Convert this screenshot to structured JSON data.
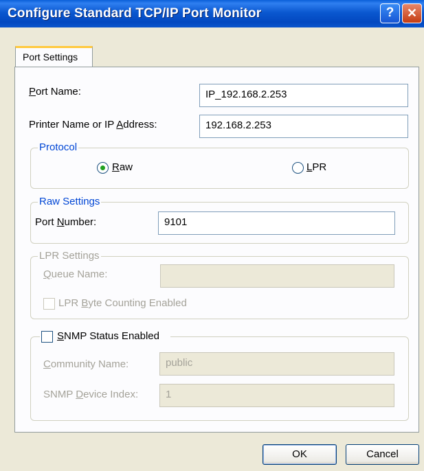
{
  "window": {
    "title": "Configure Standard TCP/IP Port Monitor",
    "help_glyph": "?",
    "close_glyph": "✕"
  },
  "tab": {
    "label": "Port Settings"
  },
  "port_name": {
    "label_pre": "",
    "label_key": "P",
    "label_post": "ort Name:",
    "value": "IP_192.168.2.253"
  },
  "printer_address": {
    "label_pre": "Printer Name or IP ",
    "label_key": "A",
    "label_post": "ddress:",
    "value": "192.168.2.253"
  },
  "protocol": {
    "legend": "Protocol",
    "raw": {
      "key": "R",
      "rest": "aw",
      "selected": true
    },
    "lpr": {
      "key": "L",
      "rest": "PR",
      "selected": false
    }
  },
  "raw_settings": {
    "legend": "Raw Settings",
    "port_number": {
      "label_pre": "Port ",
      "label_key": "N",
      "label_post": "umber:",
      "value": "9101"
    }
  },
  "lpr_settings": {
    "legend": "LPR Settings",
    "queue_name": {
      "label_key": "Q",
      "label_post": "ueue Name:",
      "value": ""
    },
    "byte_counting": {
      "label_pre": "LPR ",
      "label_key": "B",
      "label_post": "yte Counting Enabled",
      "checked": false
    }
  },
  "snmp": {
    "enabled_label_key": "S",
    "enabled_label_post": "NMP Status Enabled",
    "checked": false,
    "community": {
      "label_key": "C",
      "label_post": "ommunity Name:",
      "value": "public"
    },
    "device_index": {
      "label_pre": "SNMP ",
      "label_key": "D",
      "label_post": "evice Index:",
      "value": "1"
    }
  },
  "buttons": {
    "ok": "OK",
    "cancel": "Cancel"
  }
}
